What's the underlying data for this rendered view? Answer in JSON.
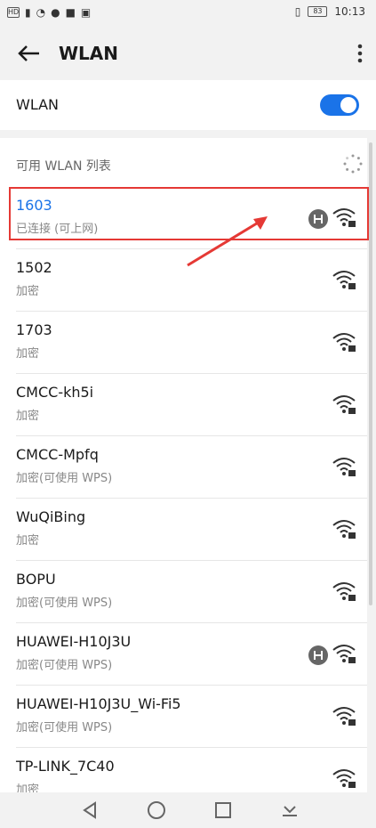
{
  "status_bar": {
    "left_icons": [
      "HD",
      "4G",
      "signal",
      "wifi",
      "app",
      "app",
      "calendar"
    ],
    "battery": "83",
    "time": "10:13"
  },
  "toolbar": {
    "title": "WLAN",
    "back_icon": "arrow-left-icon",
    "more_icon": "more-vertical-icon"
  },
  "wlan_toggle": {
    "label": "WLAN",
    "enabled": true,
    "color": "#1a73e8"
  },
  "list_header": {
    "title": "可用 WLAN 列表"
  },
  "networks": [
    {
      "name": "1603",
      "status": "已连接 (可上网)",
      "connected": true,
      "hub": true
    },
    {
      "name": "1502",
      "status": "加密",
      "connected": false,
      "hub": false
    },
    {
      "name": "1703",
      "status": "加密",
      "connected": false,
      "hub": false
    },
    {
      "name": "CMCC-kh5i",
      "status": "加密",
      "connected": false,
      "hub": false
    },
    {
      "name": "CMCC-Mpfq",
      "status": "加密(可使用 WPS)",
      "connected": false,
      "hub": false
    },
    {
      "name": "WuQiBing",
      "status": "加密",
      "connected": false,
      "hub": false
    },
    {
      "name": "BOPU",
      "status": "加密(可使用 WPS)",
      "connected": false,
      "hub": false
    },
    {
      "name": "HUAWEI-H10J3U",
      "status": "加密(可使用 WPS)",
      "connected": false,
      "hub": true
    },
    {
      "name": "HUAWEI-H10J3U_Wi-Fi5",
      "status": "加密(可使用 WPS)",
      "connected": false,
      "hub": false
    },
    {
      "name": "TP-LINK_7C40",
      "status": "加密",
      "connected": false,
      "hub": false
    }
  ],
  "colors": {
    "accent": "#1a73e8",
    "highlight": "#e53935"
  }
}
